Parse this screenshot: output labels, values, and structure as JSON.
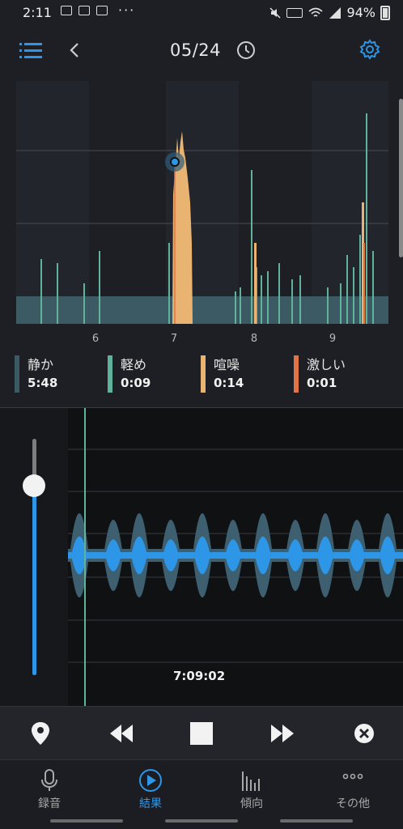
{
  "status_bar": {
    "time": "2:11",
    "dots": "···",
    "battery": "94%"
  },
  "header": {
    "date": "05/24"
  },
  "chart": {
    "x_tick_labels": [
      "6",
      "7",
      "8",
      "9"
    ]
  },
  "chart_data": {
    "type": "bar",
    "title": "",
    "xlabel": "",
    "ylabel": "",
    "x": [
      "6",
      "7",
      "8",
      "9"
    ],
    "series": [
      {
        "name": "静か",
        "color": "#3b5a63"
      },
      {
        "name": "軽め",
        "color": "#5fb39a"
      },
      {
        "name": "喧噪",
        "color": "#e9b472"
      },
      {
        "name": "激しい",
        "color": "#e07446"
      }
    ],
    "grid": true
  },
  "legend": [
    {
      "label": "静か",
      "value": "5:48",
      "color": "#3b5a63"
    },
    {
      "label": "軽め",
      "value": "0:09",
      "color": "#5fb39a"
    },
    {
      "label": "喧噪",
      "value": "0:14",
      "color": "#e9b472"
    },
    {
      "label": "激しい",
      "value": "0:01",
      "color": "#e07446"
    }
  ],
  "player": {
    "volume": 0.8,
    "current_time": "7:09:02"
  },
  "controls": [
    "marker-icon",
    "rewind-icon",
    "stop-icon",
    "fast-forward-icon",
    "close-icon"
  ],
  "nav": [
    {
      "label": "録音",
      "icon": "microphone-icon"
    },
    {
      "label": "結果",
      "icon": "play-circle-icon",
      "active": true
    },
    {
      "label": "傾向",
      "icon": "bar-chart-icon"
    },
    {
      "label": "その他",
      "icon": "more-icon"
    }
  ],
  "colors": {
    "accent": "#2d96e6",
    "background": "#1e1f24"
  }
}
